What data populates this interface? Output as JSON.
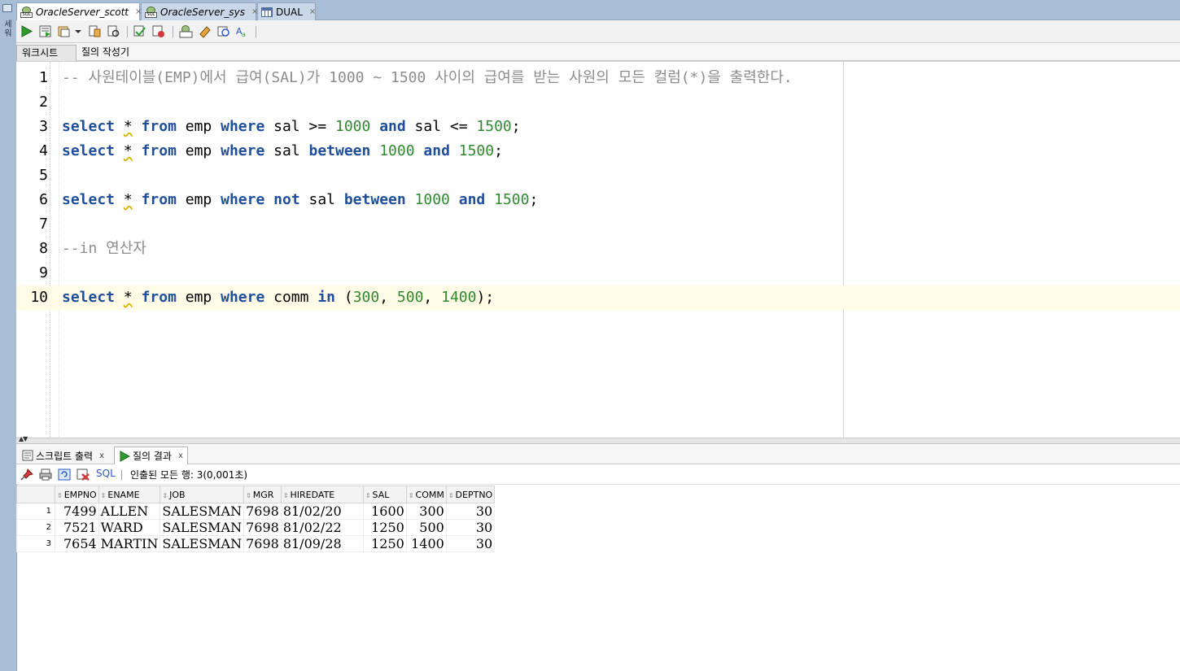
{
  "left_strip": {
    "label": "세\n워"
  },
  "tabs": [
    {
      "label": "OracleServer_scott",
      "close": "×",
      "active": true,
      "icon": "sql-connection-icon"
    },
    {
      "label": "OracleServer_sys",
      "close": "×",
      "active": false,
      "icon": "sql-connection-icon"
    },
    {
      "label": "DUAL",
      "close": "×",
      "active": false,
      "icon": "table-icon"
    }
  ],
  "toolbar": {
    "buttons": [
      "run-statement",
      "run-script",
      "autotrace",
      "explain-plan",
      "sql-tuning",
      "commit",
      "rollback",
      "unshared-sql",
      "clear",
      "history",
      "format"
    ]
  },
  "sub_tabs": {
    "worksheet": "워크시트",
    "query_builder": "질의 작성기"
  },
  "editor": {
    "lines": [
      {
        "n": "1",
        "tokens": [
          {
            "t": "-- 사원테이블(EMP)에서 급여(SAL)가 1000 ~ 1500 사이의 급여를 받는 사원의 모든 컬럼(*)을 출력한다.",
            "c": "cmt"
          }
        ]
      },
      {
        "n": "2",
        "tokens": []
      },
      {
        "n": "3",
        "tokens": [
          {
            "t": "select",
            "c": "kw"
          },
          {
            "t": " "
          },
          {
            "t": "*",
            "c": "star"
          },
          {
            "t": " "
          },
          {
            "t": "from",
            "c": "kw"
          },
          {
            "t": " emp "
          },
          {
            "t": "where",
            "c": "kw"
          },
          {
            "t": " sal >= "
          },
          {
            "t": "1000",
            "c": "num"
          },
          {
            "t": " "
          },
          {
            "t": "and",
            "c": "kw"
          },
          {
            "t": " sal <= "
          },
          {
            "t": "1500",
            "c": "num"
          },
          {
            "t": ";"
          }
        ]
      },
      {
        "n": "4",
        "tokens": [
          {
            "t": "select",
            "c": "kw"
          },
          {
            "t": " "
          },
          {
            "t": "*",
            "c": "star"
          },
          {
            "t": " "
          },
          {
            "t": "from",
            "c": "kw"
          },
          {
            "t": " emp "
          },
          {
            "t": "where",
            "c": "kw"
          },
          {
            "t": " sal "
          },
          {
            "t": "between",
            "c": "kw"
          },
          {
            "t": " "
          },
          {
            "t": "1000",
            "c": "num"
          },
          {
            "t": " "
          },
          {
            "t": "and",
            "c": "kw"
          },
          {
            "t": " "
          },
          {
            "t": "1500",
            "c": "num"
          },
          {
            "t": ";"
          }
        ]
      },
      {
        "n": "5",
        "tokens": []
      },
      {
        "n": "6",
        "tokens": [
          {
            "t": "select",
            "c": "kw"
          },
          {
            "t": " "
          },
          {
            "t": "*",
            "c": "star"
          },
          {
            "t": " "
          },
          {
            "t": "from",
            "c": "kw"
          },
          {
            "t": " emp "
          },
          {
            "t": "where",
            "c": "kw"
          },
          {
            "t": " "
          },
          {
            "t": "not",
            "c": "kw"
          },
          {
            "t": " sal "
          },
          {
            "t": "between",
            "c": "kw"
          },
          {
            "t": " "
          },
          {
            "t": "1000",
            "c": "num"
          },
          {
            "t": " "
          },
          {
            "t": "and",
            "c": "kw"
          },
          {
            "t": " "
          },
          {
            "t": "1500",
            "c": "num"
          },
          {
            "t": ";"
          }
        ]
      },
      {
        "n": "7",
        "tokens": []
      },
      {
        "n": "8",
        "tokens": [
          {
            "t": "--in 연산자",
            "c": "cmt"
          }
        ]
      },
      {
        "n": "9",
        "tokens": []
      },
      {
        "n": "10",
        "current": true,
        "tokens": [
          {
            "t": "select",
            "c": "kw"
          },
          {
            "t": " "
          },
          {
            "t": "*",
            "c": "star"
          },
          {
            "t": " "
          },
          {
            "t": "from",
            "c": "kw"
          },
          {
            "t": " emp "
          },
          {
            "t": "where",
            "c": "kw"
          },
          {
            "t": " comm "
          },
          {
            "t": "in",
            "c": "kw"
          },
          {
            "t": " ("
          },
          {
            "t": "300",
            "c": "num"
          },
          {
            "t": ", "
          },
          {
            "t": "500",
            "c": "num"
          },
          {
            "t": ", "
          },
          {
            "t": "1400",
            "c": "num"
          },
          {
            "t": ");"
          }
        ]
      }
    ]
  },
  "results": {
    "tabs": [
      {
        "label": "스크립트 출력",
        "close": "x",
        "active": false
      },
      {
        "label": "질의 결과",
        "close": "x",
        "active": true
      }
    ],
    "sql_link": "SQL",
    "status": "인출된 모든 행: 3(0,001초)",
    "columns": [
      "EMPNO",
      "ENAME",
      "JOB",
      "MGR",
      "HIREDATE",
      "SAL",
      "COMM",
      "DEPTNO"
    ],
    "rows": [
      {
        "n": "1",
        "cells": [
          "7499",
          "ALLEN",
          "SALESMAN",
          "7698",
          "81/02/20",
          "1600",
          "300",
          "30"
        ]
      },
      {
        "n": "2",
        "cells": [
          "7521",
          "WARD",
          "SALESMAN",
          "7698",
          "81/02/22",
          "1250",
          "500",
          "30"
        ]
      },
      {
        "n": "3",
        "cells": [
          "7654",
          "MARTIN",
          "SALESMAN",
          "7698",
          "81/09/28",
          "1250",
          "1400",
          "30"
        ]
      }
    ]
  },
  "colors": {
    "keyword": "#1f4e9b",
    "number": "#2f8a2f",
    "comment": "#8c8c8c",
    "current_line": "#fffbe6",
    "tab_strip": "#a9bdd6"
  }
}
